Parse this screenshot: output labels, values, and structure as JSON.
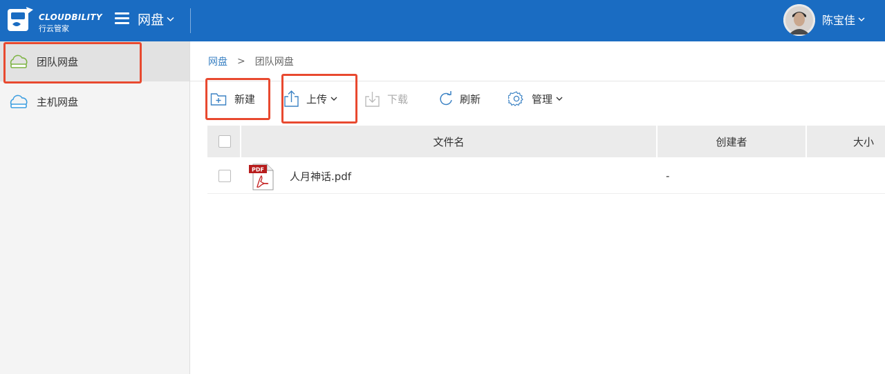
{
  "header": {
    "logo_text": "CLOUDBILITY",
    "logo_subtitle": "行云管家",
    "nav_title": "网盘",
    "user_name": "陈宝佳",
    "bg_color": "#1a6cc2"
  },
  "sidebar": {
    "items": [
      {
        "label": "团队网盘",
        "icon": "cloud-drive-icon",
        "active": true
      },
      {
        "label": "主机网盘",
        "icon": "cloud-drive-icon",
        "active": false
      }
    ]
  },
  "breadcrumb": {
    "root": "网盘",
    "separator": ">",
    "current": "团队网盘"
  },
  "toolbar": {
    "new_label": "新建",
    "upload_label": "上传",
    "download_label": "下载",
    "refresh_label": "刷新",
    "manage_label": "管理"
  },
  "table": {
    "columns": [
      "文件名",
      "创建者",
      "大小"
    ],
    "rows": [
      {
        "name": "人月神话.pdf",
        "icon_text": "PDF",
        "creator": "-",
        "size": ""
      }
    ]
  },
  "highlight_color": "#e8492f"
}
